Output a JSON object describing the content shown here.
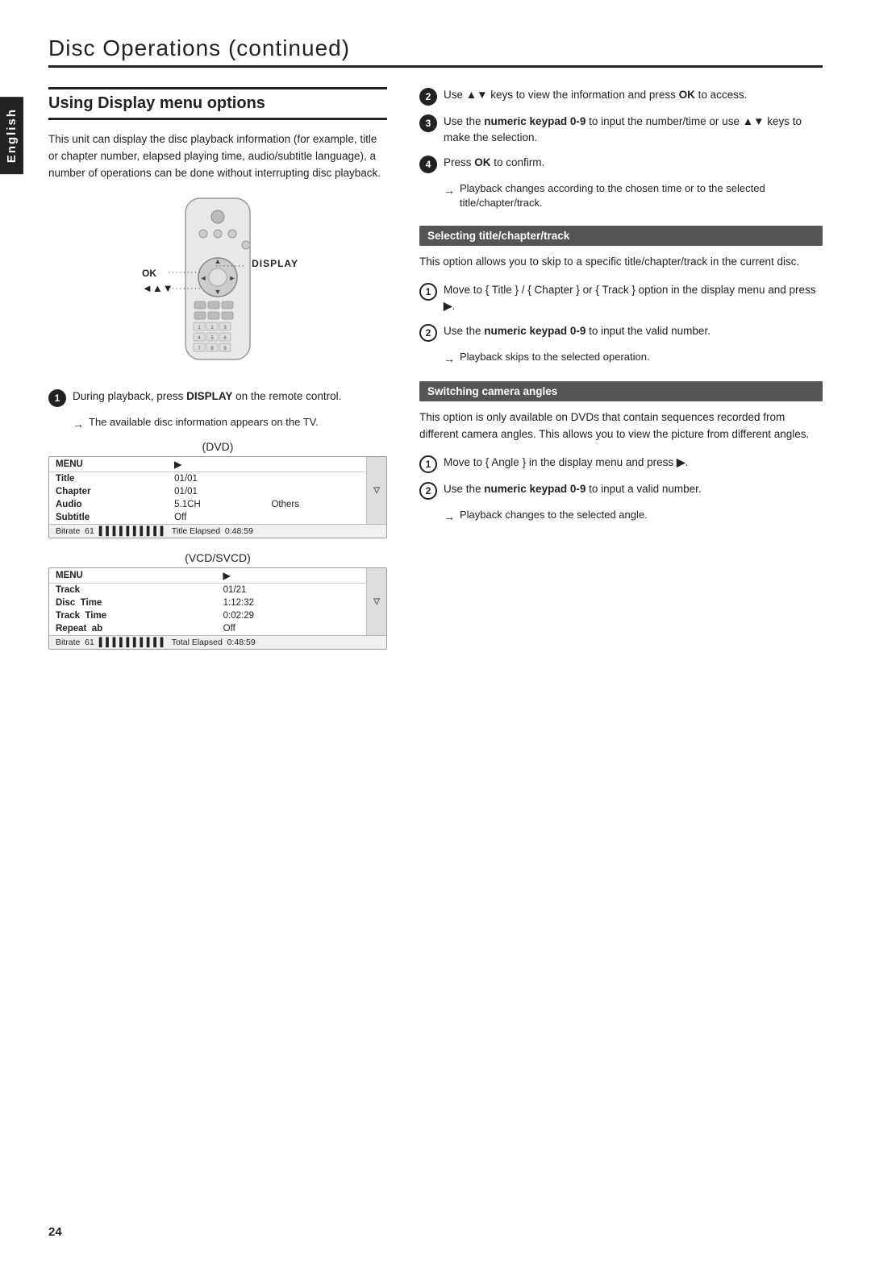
{
  "header": {
    "title": "Disc Operations",
    "subtitle": " (continued)"
  },
  "sidebar": {
    "label": "English"
  },
  "left_col": {
    "section_title": "Using Display menu options",
    "intro": "This unit can display the disc playback information (for example, title or chapter number, elapsed playing time, audio/subtitle language), a number of operations can be done without interrupting disc playback.",
    "remote": {
      "ok_label": "OK",
      "display_label": "DISPLAY",
      "arrows_label": "◄▲▼"
    },
    "dvd_label": "(DVD)",
    "dvd_display": {
      "menu_row": [
        "MENU",
        "▶"
      ],
      "rows": [
        [
          "Title",
          "01/01",
          ""
        ],
        [
          "Chapter",
          "01/01",
          ""
        ],
        [
          "Audio",
          "5.1CH",
          "Others"
        ],
        [
          "Subtitle",
          "Off",
          ""
        ]
      ],
      "bitrate_row": "Bitrate  61  ▌▌▌▌▌▌▌▌▌▌  Title Elapsed  0:48:59"
    },
    "vcd_label": "(VCD/SVCD)",
    "vcd_display": {
      "menu_row": [
        "MENU",
        "▶"
      ],
      "rows": [
        [
          "Track",
          "01/21",
          ""
        ],
        [
          "Disc  Time",
          "1:12:32",
          ""
        ],
        [
          "Track  Time",
          "0:02:29",
          ""
        ],
        [
          "Repeat  ab",
          "Off",
          ""
        ]
      ],
      "bitrate_row": "Bitrate  61  ▌▌▌▌▌▌▌▌▌▌  Total Elapsed  0:48:59"
    },
    "steps": [
      {
        "num": "1",
        "filled": true,
        "text": "During playback, press DISPLAY on the remote control.",
        "bold_word": "DISPLAY",
        "note": "The available disc information appears on the TV."
      }
    ]
  },
  "right_col": {
    "steps": [
      {
        "num": "2",
        "filled": true,
        "text": "Use ▲▼ keys to view the information and press OK to access.",
        "bold_word": "OK"
      },
      {
        "num": "3",
        "filled": true,
        "text": "Use the numeric keypad 0-9 to input the number/time or use ▲▼ keys to make the selection.",
        "bold_words": [
          "numeric keypad 0-9",
          "▲▼"
        ]
      },
      {
        "num": "4",
        "filled": true,
        "text": "Press OK to confirm.",
        "bold_word": "OK",
        "note": "Playback changes according to the chosen time or to the selected title/chapter/track."
      }
    ],
    "selecting_section": {
      "title": "Selecting title/chapter/track",
      "intro": "This option allows you to skip to a specific title/chapter/track in the current disc.",
      "steps": [
        {
          "num": "1",
          "filled": false,
          "text": "Move to { Title } / { Chapter } or { Track } option in the display menu and press ▶.",
          "bold_word": "▶"
        },
        {
          "num": "2",
          "filled": false,
          "text": "Use the numeric keypad 0-9 to input the valid number.",
          "bold_words": [
            "numeric keypad 0-9"
          ],
          "note": "Playback skips to the selected operation."
        }
      ]
    },
    "switching_section": {
      "title": "Switching camera angles",
      "intro": "This option is only available on DVDs that contain sequences recorded from different camera angles. This allows you to view the picture from different angles.",
      "steps": [
        {
          "num": "1",
          "filled": false,
          "text": "Move to { Angle } in the display menu and press ▶.",
          "bold_word": "▶"
        },
        {
          "num": "2",
          "filled": false,
          "text": "Use the numeric keypad 0-9 to input a valid number.",
          "bold_words": [
            "numeric keypad 0-9"
          ],
          "note": "Playback changes to the selected angle."
        }
      ]
    }
  },
  "page_number": "24"
}
